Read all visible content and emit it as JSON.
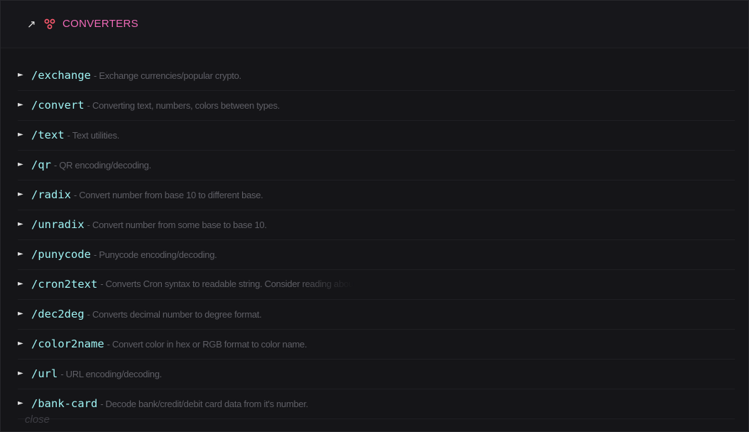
{
  "header": {
    "expand_icon": "arrow-up-right-icon",
    "section_icon": "converters-icon",
    "title": "CONVERTERS",
    "title_color": "#f06ab8",
    "icon_color": "#ff5a6e"
  },
  "commands": [
    {
      "name": "/exchange",
      "desc": "- Exchange currencies/popular crypto."
    },
    {
      "name": "/convert",
      "desc": "- Converting text, numbers, colors between types."
    },
    {
      "name": "/text",
      "desc": "- Text utilities."
    },
    {
      "name": "/qr",
      "desc": "- QR encoding/decoding."
    },
    {
      "name": "/radix",
      "desc": "- Convert number from base 10 to different base."
    },
    {
      "name": "/unradix",
      "desc": "- Convert number from some base to base 10."
    },
    {
      "name": "/punycode",
      "desc": "- Punycode encoding/decoding."
    },
    {
      "name": "/cron2text",
      "desc": "- Converts Cron syntax to readable string. Consider reading abou"
    },
    {
      "name": "/dec2deg",
      "desc": "- Converts decimal number to degree format."
    },
    {
      "name": "/color2name",
      "desc": "- Convert color in hex or RGB format to color name."
    },
    {
      "name": "/url",
      "desc": "- URL encoding/decoding."
    },
    {
      "name": "/bank-card",
      "desc": "- Decode bank/credit/debit card data from it's number."
    }
  ],
  "expand_marker_icon": "triangle-right-icon",
  "close_label": "close",
  "colors": {
    "background": "#151518",
    "command": "#9ff3f3",
    "description": "#5f5f66"
  }
}
